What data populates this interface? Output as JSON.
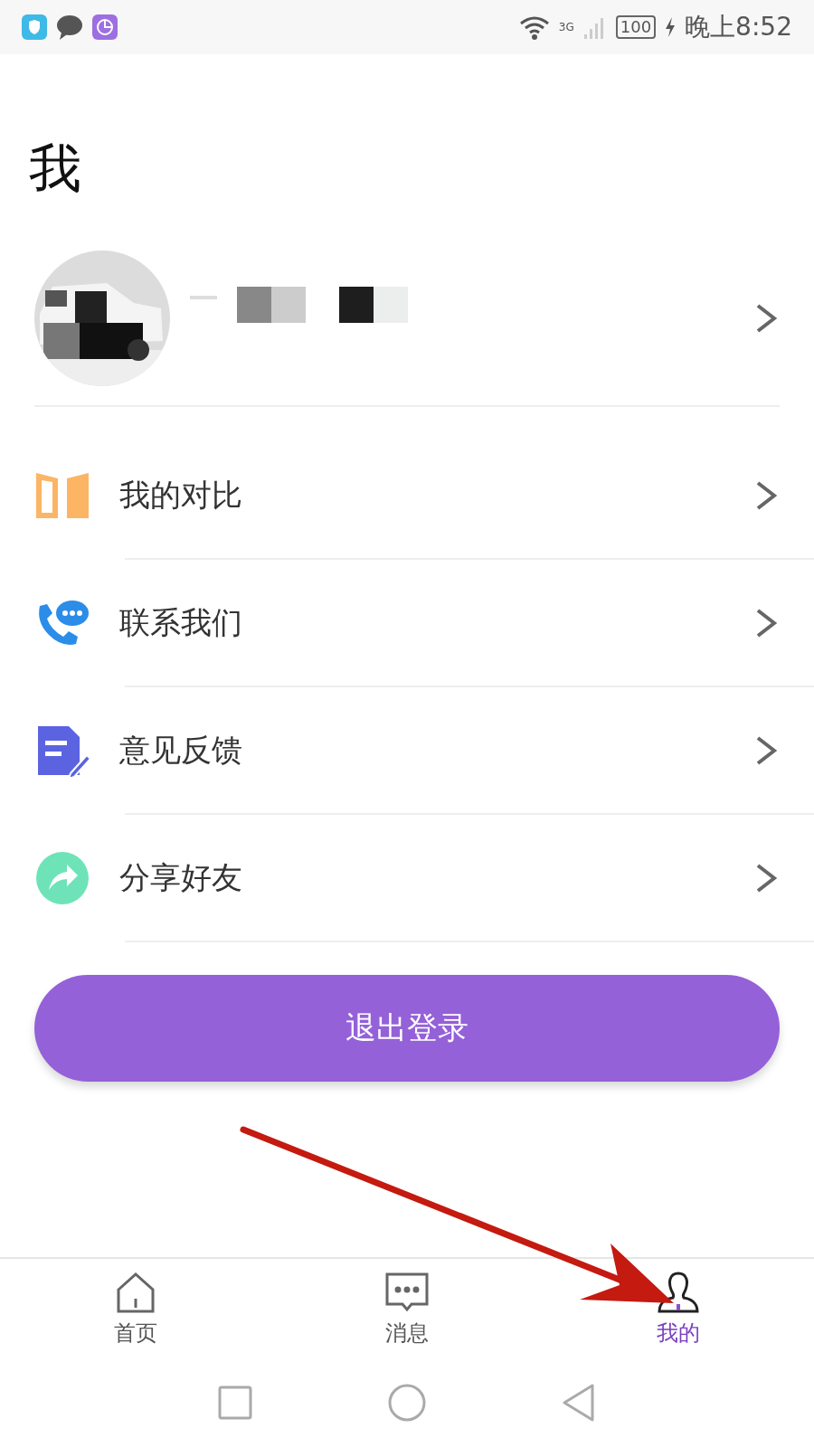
{
  "status_bar": {
    "network": "3G",
    "battery": "100",
    "time": "晚上8:52"
  },
  "title": "我",
  "profile": {
    "redacted": true
  },
  "menu": [
    {
      "kind": "compare",
      "label": "我的对比"
    },
    {
      "kind": "contact",
      "label": "联系我们"
    },
    {
      "kind": "feedback",
      "label": "意见反馈"
    },
    {
      "kind": "share",
      "label": "分享好友"
    }
  ],
  "logout_button": "退出登录",
  "tabs": [
    {
      "kind": "home",
      "label": "首页",
      "selected": false
    },
    {
      "kind": "messages",
      "label": "消息",
      "selected": false
    },
    {
      "kind": "me",
      "label": "我的",
      "selected": true
    }
  ]
}
